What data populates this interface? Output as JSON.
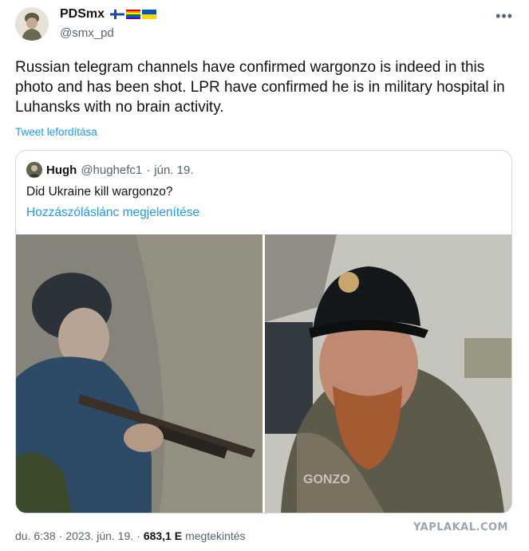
{
  "author": {
    "name": "PDSmx",
    "handle": "@smx_pd",
    "flags": [
      "finland-flag",
      "rainbow-flag",
      "ukraine-flag"
    ]
  },
  "tweet": {
    "text": "Russian telegram channels have confirmed wargonzo is indeed in this photo and has been shot. LPR have confirmed he is in military hospital in Luhansks with no brain activity.",
    "translate_label": "Tweet lefordítása"
  },
  "quoted": {
    "name": "Hugh",
    "handle": "@hughefc1",
    "date": "jún. 19.",
    "text": "Did Ukraine kill wargonzo?",
    "thread_link": "Hozzászóláslánc megjelenítése",
    "photo2_patch_text": "GONZO"
  },
  "footer": {
    "time": "du. 6:38",
    "date": "2023. jún. 19.",
    "views_count": "683,1 E",
    "views_label": "megtekintés"
  },
  "watermark": "YAPLAKAL.COM",
  "colors": {
    "link": "#1d9bf0",
    "muted": "#536471"
  }
}
